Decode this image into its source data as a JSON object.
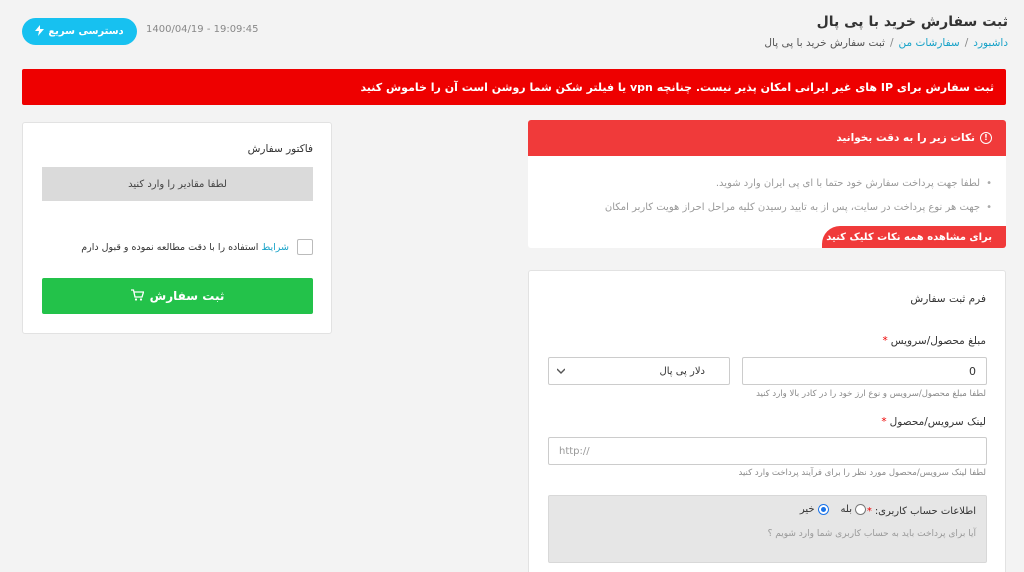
{
  "header": {
    "title": "ثبت سفارش خرید با پی پال",
    "breadcrumb": [
      "داشبورد",
      "سفارشات من",
      "ثبت سفارش خرید با پی پال"
    ],
    "datetime": "1400/04/19 - 19:09:45",
    "quick_access_label": "دسترسی سریع"
  },
  "alert": {
    "text": "ثبت سفارش برای IP های غیر ایرانی امکان پذیر نیست. چنانچه vpn یا فیلتر شکن شما روشن است آن را خاموش کنید"
  },
  "invoice": {
    "title": "فاکتور سفارش",
    "empty_text": "لطفا مقادیر را وارد کنید",
    "terms_link": "شرایط",
    "terms_text": "استفاده را با دقت مطالعه نموده و قبول دارم",
    "submit_label": "ثبت سفارش"
  },
  "notes": {
    "header": "نکات زیر را به دقت بخوانید",
    "items": [
      "لطفا جهت پرداخت سفارش خود حتما با آی پی ایران وارد شوید.",
      "جهت هر نوع پرداخت در سایت، پس از به تایید رسیدن کلیه مراحل احراز هویت کاربر امکان"
    ],
    "footer": "برای مشاهده همه نکات کلیک کنید"
  },
  "form": {
    "title": "فرم ثبت سفارش",
    "amount_label": "مبلغ محصول/سرویس",
    "amount_value": "0",
    "currency_selected": "دلار پی پال",
    "amount_hint": "لطفا مبلغ محصول/سرویس و نوع ارز خود را در کادر بالا وارد کنید",
    "link_label": "لینک سرویس/محصول",
    "link_placeholder": "http://",
    "link_hint": "لطفا لینک سرویس/محصول مورد نظر را برای فرآیند پرداخت وارد کنید",
    "account_label": "اطلاعات حساب کاربری:",
    "radio_yes": "بله",
    "radio_no": "خیر",
    "account_hint": "آیا برای پرداخت باید به حساب کاربری شما وارد شویم ؟",
    "required_mark": "*"
  },
  "colors": {
    "alert_red": "#ee0000",
    "notes_red": "#f03a3a",
    "submit_green": "#23c24a",
    "quick_blue": "#17c1f0",
    "link_blue": "#17a2c8"
  },
  "icons": {
    "quick_access": "lightning-icon",
    "submit": "cart-icon",
    "notes": "info-icon",
    "select": "chevron-down-icon"
  }
}
